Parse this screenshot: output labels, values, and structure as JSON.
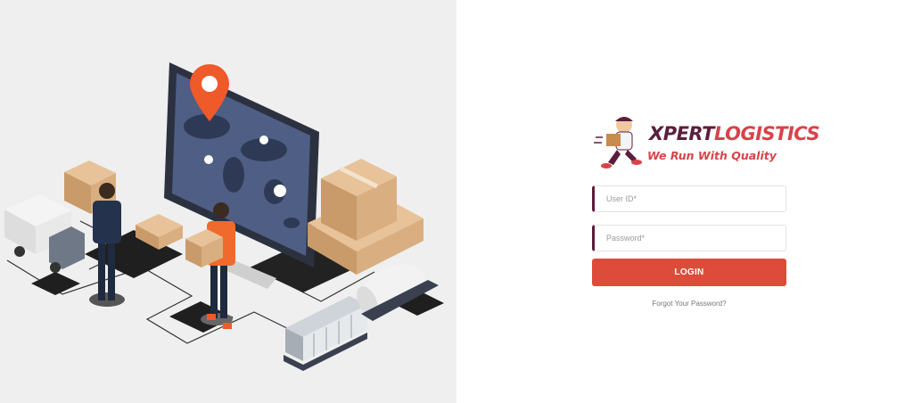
{
  "login": {
    "brand_part1": "XPERT",
    "brand_part2": "LOGISTICS",
    "tagline": "We Run With Quality",
    "user_id_placeholder": "User ID*",
    "password_placeholder": "Password*",
    "login_button": "LOGIN",
    "forgot_password": "Forgot Your Password?"
  },
  "colors": {
    "left_background": "#efefef",
    "brand_dark": "#5a1e3c",
    "brand_red": "#d8434a",
    "button": "#dd4b3a",
    "field_accent": "#5a1e3c"
  },
  "illustration": {
    "icons": [
      "monitor-world-map-icon",
      "location-pin-icon",
      "delivery-truck-icon",
      "cardboard-box-icon",
      "worker-icon",
      "train-wagon-icon",
      "tanker-icon"
    ]
  }
}
